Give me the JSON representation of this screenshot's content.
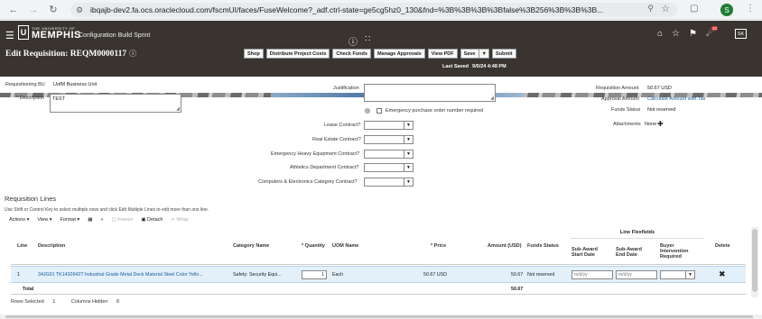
{
  "browser": {
    "url": "ibqajb-dev2.fa.ocs.oraclecloud.com/fscmUI/faces/FuseWelcome?_adf.ctrl-state=ge5cg5hz0_130&fnd=%3B%3B%3B%3Bfalse%3B256%3B%3B%3B...",
    "profile_initial": "S",
    "back_icon": "arrow-left-icon",
    "forward_icon": "arrow-right-icon",
    "reload_icon": "reload-icon"
  },
  "header": {
    "logo_small": "THE UNIVERSITY OF",
    "logo_big": "MEMPHIS",
    "logo_mark": "U",
    "sandbox": "Configuration Build Sprint",
    "notification_count": "20",
    "user_initials": "SK",
    "page_title": "Edit Requisition: REQM0000117",
    "help_icon": "?"
  },
  "toolbar": {
    "shop": "Shop",
    "distribute": "Distribute Project Costs",
    "check_funds": "Check Funds",
    "manage_approvals": "Manage Approvals",
    "view_pdf": "View PDF",
    "save": "Save",
    "submit": "Submit",
    "last_saved_label": "Last Saved",
    "last_saved_value": "9/5/24 4:48 PM"
  },
  "form": {
    "requisitioning_bu_label": "Requisitioning BU",
    "requisitioning_bu_value": "UofM Business Unit",
    "description_label": "Description",
    "description_value": "TEST",
    "required_mark": "*",
    "justification_label": "Justification",
    "emergency_label": "Emergency purchase order number required",
    "lease_label": "Lease Contract?",
    "real_estate_label": "Real Estate Contract?",
    "emergency_equipment_label": "Emergency Heavy Equipment Contract?",
    "athletics_label": "Athletics Department Contract?",
    "computers_label": "Computers & Electronics Category Contract?",
    "requisition_amount_label": "Requisition Amount",
    "requisition_amount_value": "50.67  USD",
    "approval_amount_label": "Approval Amount",
    "approval_amount_value": "Calculate Amount with Tax",
    "funds_status_label": "Funds Status",
    "funds_status_value": "Not reserved",
    "attachments_label": "Attachments",
    "attachments_value": "None"
  },
  "lines": {
    "title": "Requisition Lines",
    "hint": "Use Shift or Control Key to select multiple rows and click Edit Multiple Lines to edit more than one line.",
    "actions": "Actions",
    "view": "View",
    "format": "Format",
    "freeze": "Freeze",
    "detach": "Detach",
    "wrap": "Wrap",
    "columns": {
      "line": "Line",
      "description": "Description",
      "category": "Category Name",
      "quantity": "Quantity",
      "uom": "UOM Name",
      "price": "Price",
      "amount": "Amount (USD)",
      "funds_status": "Funds Status",
      "flexfields": "Line Flexfields",
      "sub_award_start": "Sub-Award Start Date",
      "sub_award_end": "Sub-Award End Date",
      "buyer_intervention": "Buyer Intervention Required",
      "delete": "Delete"
    },
    "rows": [
      {
        "line": "1",
        "description": "34JG91 TK1432642T Industrial Grade Metal Deck Material Steel Color Yello...",
        "category": "Safety: Security Equi...",
        "quantity": "1",
        "uom": "Each",
        "price": "50.67 USD",
        "amount": "50.67",
        "funds_status": "Not reserved",
        "start_placeholder": "m/d/yy",
        "end_placeholder": "m/d/yy"
      }
    ],
    "total_label": "Total",
    "total_value": "50.67",
    "rows_selected_label": "Rows Selected",
    "rows_selected_value": "1",
    "columns_hidden_label": "Columns Hidden",
    "columns_hidden_value": "8"
  }
}
